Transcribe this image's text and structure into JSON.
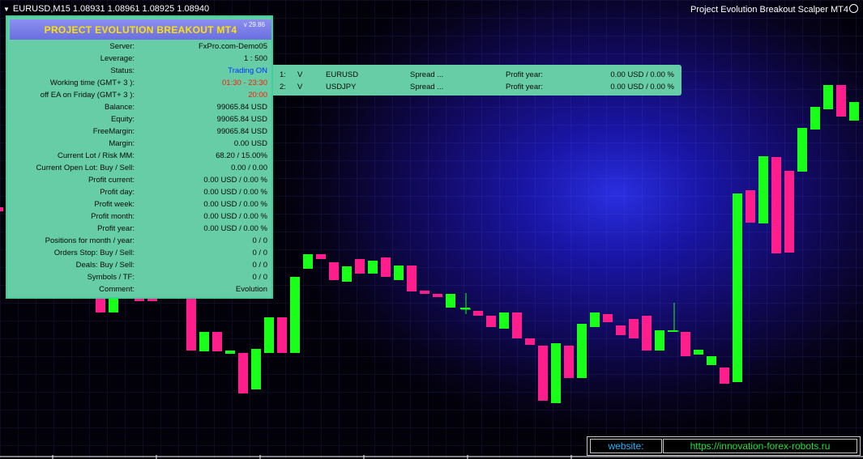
{
  "chart": {
    "symbol_line": "EURUSD,M15  1.08931 1.08961 1.08925 1.08940",
    "ea_name": "Project Evolution Breakout Scalper MT4",
    "bull_color": "#19ff19",
    "bear_color": "#ff1e8c",
    "background_color": "#120a62"
  },
  "panel": {
    "title": "PROJECT EVOLUTION BREAKOUT MT4",
    "version": "v 29.86",
    "rows": [
      {
        "label": "Server:",
        "value": "FxPro.com-Demo05",
        "color": "#0a0a0a"
      },
      {
        "label": "Leverage:",
        "value": "1 : 500",
        "color": "#0a0a0a"
      },
      {
        "label": "Status:",
        "value": "Trading ON",
        "color": "#0033ff"
      },
      {
        "label": "Working time (GMT+ 3 ):",
        "value": "01:30 - 23:30",
        "color": "#ff1a00"
      },
      {
        "label": "off EA on Friday (GMT+ 3 ):",
        "value": "20:00",
        "color": "#ff1a00"
      },
      {
        "label": "Balance:",
        "value": "99065.84 USD",
        "color": "#0a0a0a"
      },
      {
        "label": "Equity:",
        "value": "99065.84 USD",
        "color": "#0a0a0a"
      },
      {
        "label": "FreeMargin:",
        "value": "99065.84 USD",
        "color": "#0a0a0a"
      },
      {
        "label": "Margin:",
        "value": "0.00 USD",
        "color": "#0a0a0a"
      },
      {
        "label": "Current Lot / Risk MM:",
        "value": "68.20 / 15.00%",
        "color": "#0a0a0a"
      },
      {
        "label": "Current Open Lot: Buy / Sell:",
        "value": "0.00   /   0.00",
        "color": "#0a0a0a"
      },
      {
        "label": "Profit current:",
        "value": "0.00 USD / 0.00 %",
        "color": "#0a0a0a"
      },
      {
        "label": "Profit day:",
        "value": "0.00 USD / 0.00 %",
        "color": "#0a0a0a"
      },
      {
        "label": "Profit week:",
        "value": "0.00 USD / 0.00 %",
        "color": "#0a0a0a"
      },
      {
        "label": "Profit month:",
        "value": "0.00 USD / 0.00 %",
        "color": "#0a0a0a"
      },
      {
        "label": "Profit year:",
        "value": "0.00 USD / 0.00 %",
        "color": "#0a0a0a"
      },
      {
        "label": "Positions for month / year:",
        "value": "0   /   0",
        "color": "#0a0a0a"
      },
      {
        "label": "Orders Stop: Buy / Sell:",
        "value": "0   /   0",
        "color": "#0a0a0a"
      },
      {
        "label": "Deals: Buy / Sell:",
        "value": "0   /   0",
        "color": "#0a0a0a"
      },
      {
        "label": "Symbols / TF:",
        "value": "0   /   0",
        "color": "#0a0a0a"
      },
      {
        "label": "Comment:",
        "value": "Evolution",
        "color": "#0a0a0a"
      }
    ]
  },
  "symbols": [
    {
      "index": "1:",
      "flag": "V",
      "symbol": "EURUSD",
      "spread": "Spread ...",
      "profit_label": "Profit year:",
      "profit_value": "0.00 USD / 0.00 %"
    },
    {
      "index": "2:",
      "flag": "V",
      "symbol": "USDJPY",
      "spread": "Spread ...",
      "profit_label": "Profit year:",
      "profit_value": "0.00 USD / 0.00 %"
    }
  ],
  "website": {
    "label": "website:",
    "url": "https://innovation-forex-robots.ru"
  }
}
